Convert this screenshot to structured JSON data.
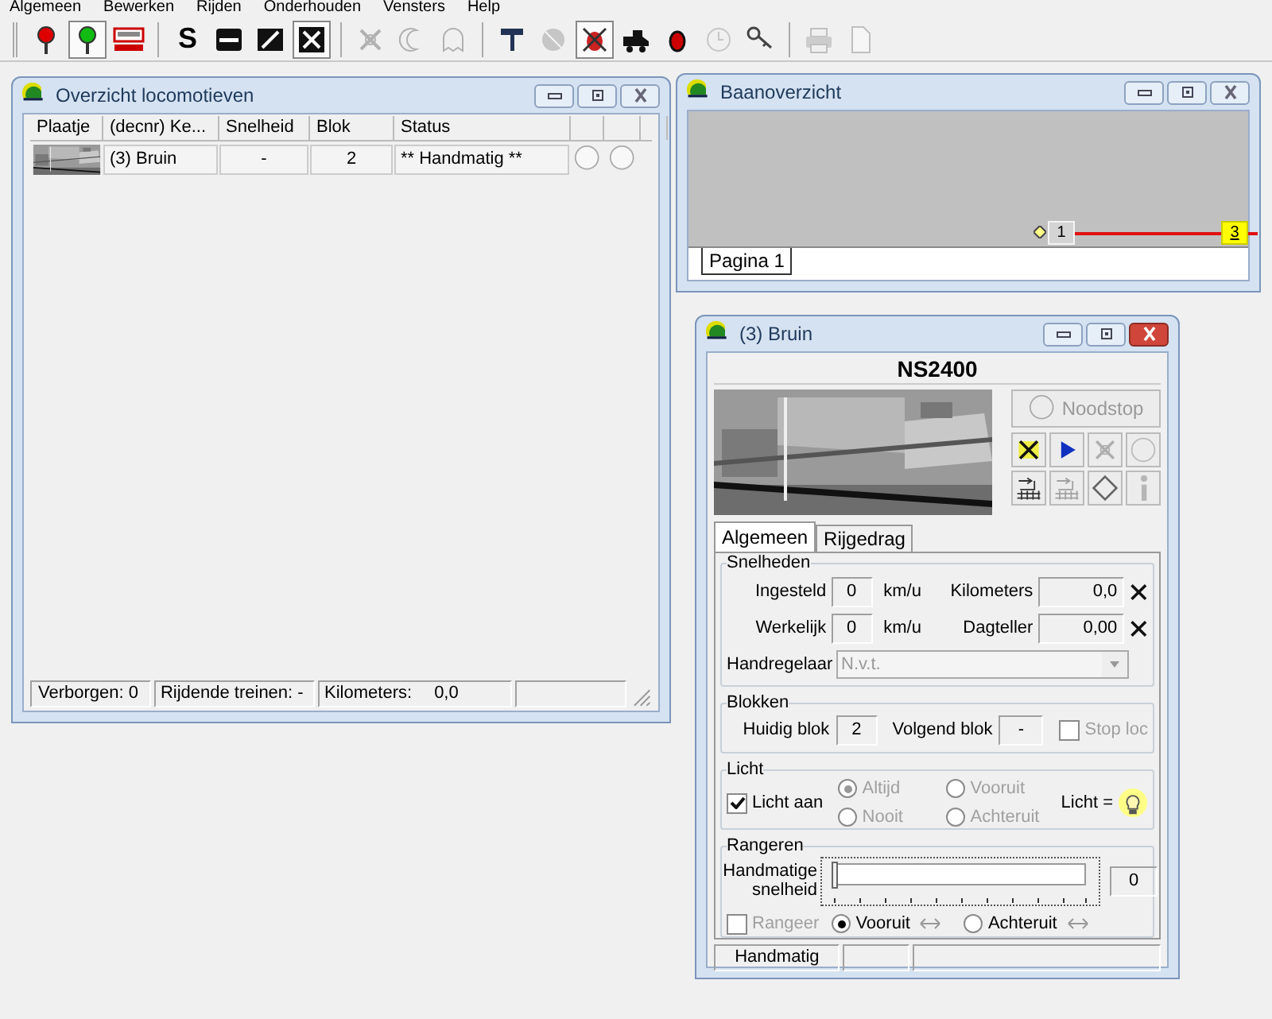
{
  "menu": [
    "Algemeen",
    "Bewerken",
    "Rijden",
    "Onderhouden",
    "Vensters",
    "Help"
  ],
  "toolbar": [
    {
      "kind": "signal-red",
      "pressed": false,
      "disabled": false
    },
    {
      "kind": "signal-green",
      "pressed": true,
      "disabled": false
    },
    {
      "kind": "panel",
      "pressed": false,
      "disabled": false
    },
    {
      "kind": "separator"
    },
    {
      "kind": "text",
      "label": "S",
      "pressed": false,
      "disabled": false
    },
    {
      "kind": "minus-box",
      "pressed": false,
      "disabled": false
    },
    {
      "kind": "slash-box",
      "pressed": false,
      "disabled": false
    },
    {
      "kind": "x-box",
      "pressed": true,
      "disabled": false
    },
    {
      "kind": "separator"
    },
    {
      "kind": "cross",
      "pressed": false,
      "disabled": true
    },
    {
      "kind": "crescent",
      "pressed": false,
      "disabled": true
    },
    {
      "kind": "ghost",
      "pressed": false,
      "disabled": true
    },
    {
      "kind": "separator"
    },
    {
      "kind": "hammer",
      "pressed": false,
      "disabled": false
    },
    {
      "kind": "disc",
      "pressed": false,
      "disabled": true
    },
    {
      "kind": "bug",
      "pressed": true,
      "disabled": false
    },
    {
      "kind": "locomotive",
      "pressed": false,
      "disabled": false
    },
    {
      "kind": "dot",
      "pressed": false,
      "disabled": false
    },
    {
      "kind": "clock",
      "pressed": false,
      "disabled": true
    },
    {
      "kind": "key",
      "pressed": false,
      "disabled": false
    },
    {
      "kind": "separator"
    },
    {
      "kind": "printer",
      "pressed": false,
      "disabled": true
    },
    {
      "kind": "page",
      "pressed": false,
      "disabled": true
    }
  ],
  "loco_overview": {
    "title": "Overzicht locomotieven",
    "columns": [
      "Plaatje",
      "(decnr) Ke...",
      "Snelheid",
      "Blok",
      "Status"
    ],
    "rows": [
      {
        "kind": "picture",
        "name": "(3) Bruin",
        "speed": "-",
        "block": "2",
        "status": "** Handmatig **"
      }
    ],
    "status_bar": {
      "hidden": "Verborgen: 0",
      "driving": "Rijdende treinen: -",
      "km_label": "Kilometers:",
      "km_value": "0,0"
    }
  },
  "track_overview": {
    "title": "Baanoverzicht",
    "blocks": [
      {
        "label": "1",
        "occupied": false
      },
      {
        "label": "3",
        "occupied": true
      }
    ],
    "tabs": [
      {
        "label": "Pagina 1",
        "selected": true
      }
    ]
  },
  "loco_control": {
    "title": "(3) Bruin",
    "loco_name": "NS2400",
    "emergency_stop": {
      "label": "Noodstop",
      "disabled": true
    },
    "buttons": [
      {
        "kind": "stop-x",
        "disabled": false
      },
      {
        "kind": "play",
        "disabled": false
      },
      {
        "kind": "cross",
        "disabled": true
      },
      {
        "kind": "circle",
        "disabled": true
      },
      {
        "kind": "shunt",
        "disabled": false
      },
      {
        "kind": "shunt",
        "disabled": true
      },
      {
        "kind": "diamond",
        "disabled": false
      },
      {
        "kind": "info",
        "disabled": true
      }
    ],
    "tabs": [
      {
        "label": "Algemeen",
        "selected": true
      },
      {
        "label": "Rijgedrag",
        "selected": false
      }
    ],
    "speeds": {
      "title": "Snelheden",
      "rows": [
        {
          "label": "Ingesteld",
          "value": "0",
          "unit": "km/u",
          "counter_label": "Kilometers",
          "counter_value": "0,0"
        },
        {
          "label": "Werkelijk",
          "value": "0",
          "unit": "km/u",
          "counter_label": "Dagteller",
          "counter_value": "0,00"
        }
      ],
      "controller": {
        "label": "Handregelaar",
        "value": "N.v.t.",
        "disabled": true
      }
    },
    "blocks": {
      "title": "Blokken",
      "current_label": "Huidig blok",
      "current": "2",
      "next_label": "Volgend blok",
      "next": "-",
      "stop": {
        "label": "Stop loc",
        "checked": false,
        "disabled": true
      }
    },
    "light": {
      "title": "Licht",
      "switch": {
        "label": "Licht aan",
        "checked": true
      },
      "modes": [
        {
          "label": "Altijd",
          "selected": true,
          "disabled": true
        },
        {
          "label": "Vooruit",
          "selected": false,
          "disabled": true
        },
        {
          "label": "Nooit",
          "selected": false,
          "disabled": true
        },
        {
          "label": "Achteruit",
          "selected": false,
          "disabled": true
        }
      ],
      "indicator_label": "Licht =",
      "lit": true
    },
    "shunting": {
      "title": "Rangeren",
      "speed_label": "Handmatige snelheid",
      "level": 0,
      "value": "0",
      "shunt": {
        "label": "Rangeer",
        "checked": false,
        "disabled": true
      },
      "directions": [
        {
          "label": "Vooruit",
          "selected": true
        },
        {
          "label": "Achteruit",
          "selected": false
        }
      ]
    },
    "status_bar": [
      "Handmatig"
    ]
  }
}
